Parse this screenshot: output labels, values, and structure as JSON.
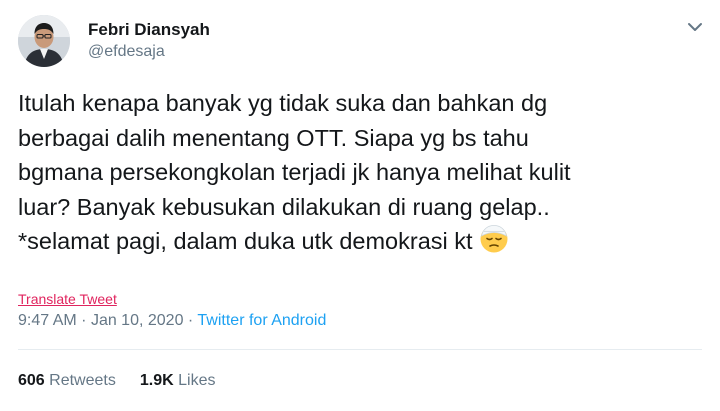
{
  "author": {
    "display_name": "Febri Diansyah",
    "handle": "@efdesaja"
  },
  "tweet": {
    "lines": [
      "Itulah kenapa banyak yg tidak suka dan bahkan dg",
      "berbagai dalih menentang OTT. Siapa yg bs tahu",
      "bgmana persekongkolan terjadi jk hanya melihat kulit",
      "luar? Banyak kebusukan dilakukan di ruang gelap..",
      "*selamat pagi, dalam duka utk demokrasi kt"
    ],
    "emoji": "face-with-head-bandage-icon"
  },
  "translate_label": "Translate Tweet",
  "meta": {
    "time": "9:47 AM",
    "separator": "·",
    "date": "Jan 10, 2020",
    "source": "Twitter for Android"
  },
  "stats": {
    "retweets_count": "606",
    "retweets_label": "Retweets",
    "likes_count": "1.9K",
    "likes_label": "Likes"
  },
  "colors": {
    "text": "#14171a",
    "muted": "#657786",
    "link_blue": "#1da1f2",
    "translate_pink": "#e0245e",
    "divider": "#e6ecf0"
  }
}
